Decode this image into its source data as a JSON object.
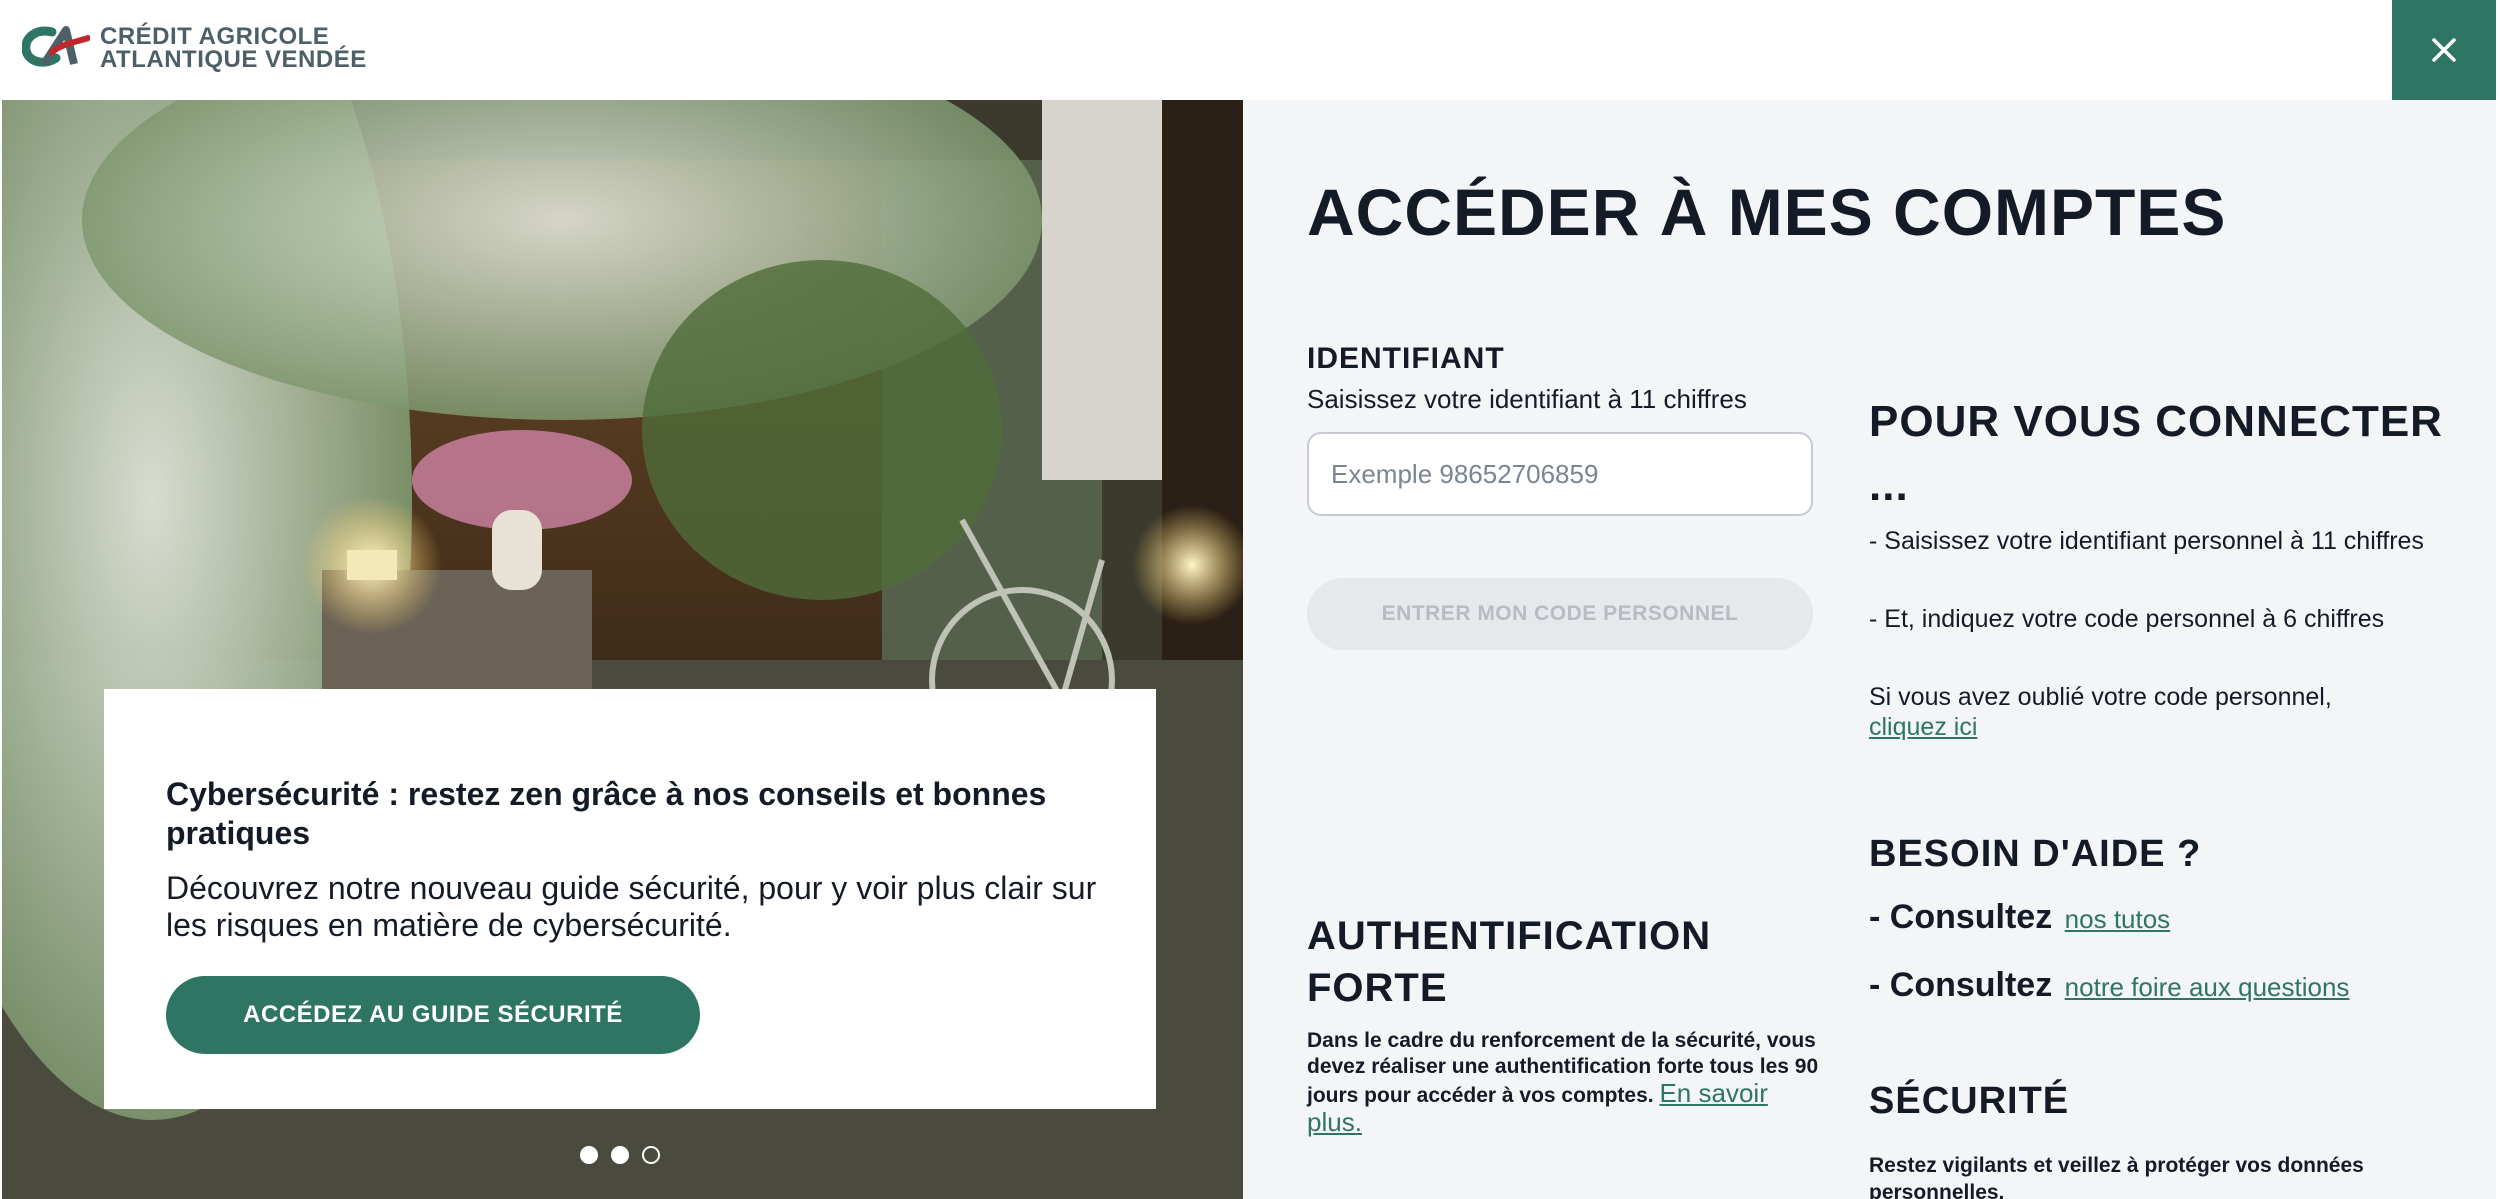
{
  "header": {
    "brand_line1": "CRÉDIT AGRICOLE",
    "brand_line2": "ATLANTIQUE VENDÉE",
    "close_icon": "close-icon"
  },
  "promo": {
    "title": "Cybersécurité : restez zen grâce à nos conseils et bonnes pratiques",
    "text": "Découvrez notre nouveau guide sécurité, pour y voir plus clair sur les risques en matière de cybersécurité.",
    "button_label": "ACCÉDEZ AU GUIDE SÉCURITÉ",
    "carousel": {
      "slide_count": 3,
      "active_slides": [
        1,
        2
      ]
    }
  },
  "login": {
    "title": "ACCÉDER À MES COMPTES",
    "id_label": "IDENTIFIANT",
    "id_help": "Saisissez votre identifiant à 11 chiffres",
    "id_value": "",
    "id_placeholder": "Exemple 98652706859",
    "code_button_label": "ENTRER MON CODE PERSONNEL"
  },
  "auth": {
    "title": "AUTHENTIFICATION FORTE",
    "text": "Dans le cadre du renforcement de la sécurité, vous devez réaliser une authentification forte tous les 90 jours pour accéder à vos comptes.",
    "link_label": "En savoir plus."
  },
  "connect": {
    "title": "POUR VOUS CONNECTER ...",
    "item1": "- Saisissez votre identifiant personnel à 11 chiffres",
    "item2": "- Et, indiquez votre code personnel à 6 chiffres",
    "item3_text": "Si vous avez oublié votre code personnel,",
    "item3_link": "cliquez ici"
  },
  "help": {
    "title": "BESOIN D'AIDE ?",
    "row1_prefix": "- Consultez",
    "row1_link": "nos tutos",
    "row2_prefix": "- Consultez",
    "row2_link": "notre foire aux questions"
  },
  "security": {
    "title": "SÉCURITÉ",
    "text": "Restez vigilants et veillez à protéger vos données personnelles."
  },
  "colors": {
    "brand_green": "#2e7563",
    "panel_bg": "#f4f5f7",
    "text_dark": "#151b26",
    "logo_grey": "#4d6068"
  }
}
